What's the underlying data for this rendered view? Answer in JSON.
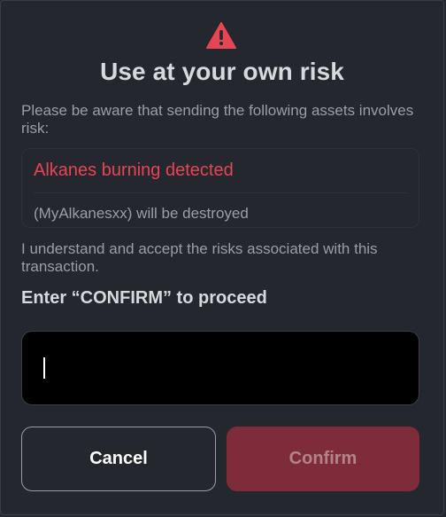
{
  "dialog": {
    "icon": "warning-triangle-icon",
    "title": "Use at your own risk",
    "intro": "Please be aware that sending the following assets involves risk:",
    "warning": {
      "heading": "Alkanes burning detected",
      "detail": "(MyAlkanesxx) will be destroyed"
    },
    "accept_text": "I understand and accept the risks associated with this transaction.",
    "prompt": "Enter “CONFIRM” to proceed",
    "input": {
      "value": "",
      "placeholder": ""
    },
    "buttons": {
      "cancel": "Cancel",
      "confirm": "Confirm"
    }
  },
  "colors": {
    "background": "#24272d",
    "danger": "#e64553",
    "confirm_disabled_bg": "#7f2c3a",
    "text_primary": "#d8d9dc",
    "text_secondary": "#9a9ea6"
  }
}
